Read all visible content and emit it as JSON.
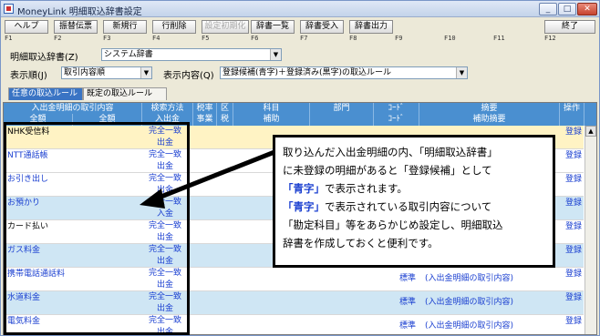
{
  "window": {
    "title": "MoneyLink 明細取込辞書設定"
  },
  "toolbar": {
    "buttons": [
      {
        "label": "ヘルプ",
        "fkey": "F1",
        "disabled": false
      },
      {
        "label": "振替伝票",
        "fkey": "F2",
        "disabled": false
      },
      {
        "label": "新規行",
        "fkey": "F3",
        "disabled": false
      },
      {
        "label": "行削除",
        "fkey": "F4",
        "disabled": false
      },
      {
        "label": "設定初期化",
        "fkey": "F5",
        "disabled": true
      },
      {
        "label": "辞書一覧",
        "fkey": "F6",
        "disabled": false
      },
      {
        "label": "辞書受入",
        "fkey": "F7",
        "disabled": false
      },
      {
        "label": "辞書出力",
        "fkey": "F8",
        "disabled": false
      },
      {
        "label": "終了",
        "fkey": "F12",
        "disabled": false
      }
    ],
    "extra_fkeys": [
      "F9",
      "F10",
      "F11"
    ]
  },
  "form": {
    "dict_label": "明細取込辞書(Z)",
    "dict_value": "システム辞書",
    "order_label": "表示順(J)",
    "order_value": "取引内容順",
    "content_label": "表示内容(Q)",
    "content_value": "登録候補(青字)＋登録済み(黒字)の取込ルール"
  },
  "tabs": [
    {
      "label": "任意の取込ルール",
      "active": true
    },
    {
      "label": "既定の取込ルール",
      "active": false
    }
  ],
  "grid": {
    "headers": {
      "group_title": "入出金明細の取引内容",
      "sub_partial": "全額",
      "sub_partial2": "全額",
      "method": "検索方法",
      "method_sub": "入出金",
      "tax": "税率",
      "tax_sub": "事業",
      "kubun": "区",
      "kubun_sub": "税",
      "account": "科目",
      "account_sub": "補助",
      "dept": "部門",
      "code": "ｺｰﾄﾞ",
      "code_sub": "ｺｰﾄﾞ",
      "summary": "摘要",
      "summary_sub": "補助摘要",
      "ops": "操作"
    },
    "rows": [
      {
        "name": "NHK受信料",
        "method1": "完全一致",
        "method2": "出金",
        "std": "",
        "summary": "",
        "op": "登録",
        "style": "highlight",
        "name_color": "black"
      },
      {
        "name": "NTT通話帳",
        "method1": "完全一致",
        "method2": "出金",
        "std": "",
        "summary": "",
        "op": "登録",
        "style": "white",
        "name_color": "blue"
      },
      {
        "name": "お引き出し",
        "method1": "完全一致",
        "method2": "出金",
        "std": "",
        "summary": "",
        "op": "登録",
        "style": "white",
        "name_color": "blue"
      },
      {
        "name": "お預かり",
        "method1": "完全一致",
        "method2": "入金",
        "std": "",
        "summary": "",
        "op": "登録",
        "style": "blue",
        "name_color": "blue"
      },
      {
        "name": "カード払い",
        "method1": "完全一致",
        "method2": "出金",
        "std": "",
        "summary": "",
        "op": "登録",
        "style": "white",
        "name_color": "black"
      },
      {
        "name": "ガス料金",
        "method1": "完全一致",
        "method2": "出金",
        "std": "",
        "summary": "",
        "op": "登録",
        "style": "blue",
        "name_color": "blue"
      },
      {
        "name": "携帯電話通話料",
        "method1": "完全一致",
        "method2": "出金",
        "std": "標準",
        "summary": "(入出金明細の取引内容)",
        "op": "登録",
        "style": "white",
        "name_color": "blue"
      },
      {
        "name": "水道料金",
        "method1": "完全一致",
        "method2": "出金",
        "std": "標準",
        "summary": "(入出金明細の取引内容)",
        "op": "登録",
        "style": "blue",
        "name_color": "blue"
      },
      {
        "name": "電気料金",
        "method1": "完全一致",
        "method2": "出金",
        "std": "標準",
        "summary": "(入出金明細の取引内容)",
        "op": "登録",
        "style": "white",
        "name_color": "blue"
      }
    ]
  },
  "callout": {
    "line1": "取り込んだ入出金明細の内、「明細取込辞書」",
    "line2": "に未登録の明細があると「登録候補」として",
    "line3_em": "「青字」",
    "line3_rest": "で表示されます。",
    "line4_em": "「青字」",
    "line4_rest": "で表示されている取引内容について",
    "line5": "「勘定科目」等をあらかじめ設定し、明細取込",
    "line6": "辞書を作成しておくと便利です。"
  },
  "colors": {
    "accent_blue": "#1a3fd0",
    "header_blue": "#4a8fd0",
    "row_blue": "#cfe6f4"
  }
}
